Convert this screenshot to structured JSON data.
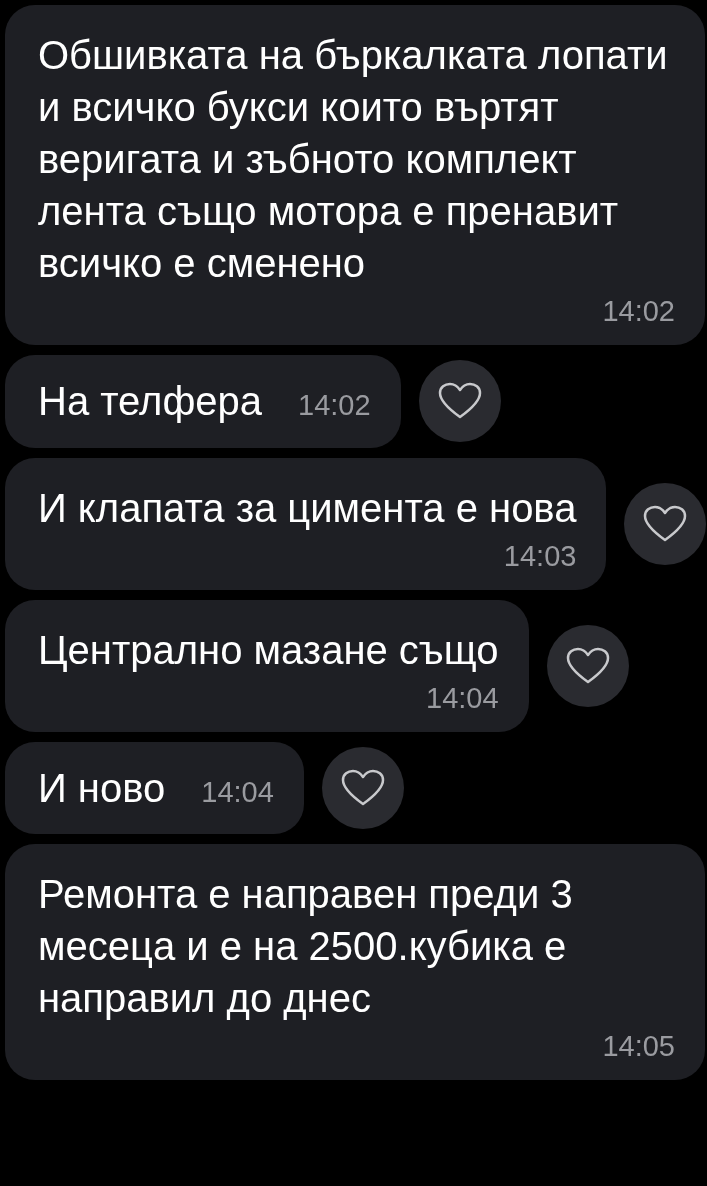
{
  "messages": [
    {
      "text": "Обшивката на бъркалката лопати  и всичко букси които въртят веригата и зъбното комплект лента също мотора е пренавит  всичко е сменено",
      "time": "14:02",
      "kind": "block",
      "reaction": false
    },
    {
      "text": "На телфера",
      "time": "14:02",
      "kind": "inline",
      "reaction": true
    },
    {
      "text": "И клапата за цимента е нова",
      "time": "14:03",
      "kind": "block",
      "reaction": true
    },
    {
      "text": "Централно мазане също",
      "time": "14:04",
      "kind": "block",
      "reaction": true
    },
    {
      "text": "И ново",
      "time": "14:04",
      "kind": "inline",
      "reaction": true
    },
    {
      "text": "Ремонта е направен преди 3 месеца и е на 2500.кубика е направил до днес",
      "time": "14:05",
      "kind": "block",
      "reaction": false
    }
  ]
}
